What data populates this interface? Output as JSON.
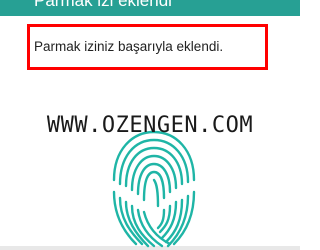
{
  "header": {
    "title": "Parmak izi eklendi"
  },
  "message": {
    "text": "Parmak iziniz başarıyla eklendi."
  },
  "watermark": {
    "text": "WWW.OZENGEN.COM"
  },
  "colors": {
    "header_bg": "#27a094",
    "highlight_border": "#ff0000",
    "fingerprint": "#1fb5a6"
  },
  "icons": {
    "fingerprint": "fingerprint-icon"
  }
}
